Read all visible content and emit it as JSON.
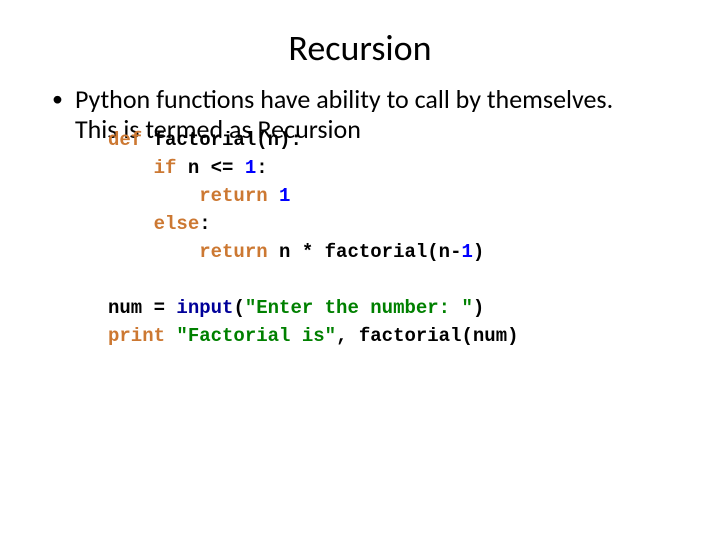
{
  "title": "Recursion",
  "bullet": "Python functions have ability to call by  themselves. This is termed as Recursion",
  "code": {
    "l1_def": "def ",
    "l1_fn": "factorial",
    "l1_rest": "(n):",
    "l2_if": "if ",
    "l2_cond": "n <= ",
    "l2_one": "1",
    "l2_colon": ":",
    "l3_ret": "return ",
    "l3_one": "1",
    "l4_else": "else",
    "l4_colon": ":",
    "l5_ret": "return ",
    "l5_expr1": "n * factorial(n-",
    "l5_expr2": "1",
    "l5_expr3": ")",
    "l6_num": "num = ",
    "l6_input": "input",
    "l6_open": "(",
    "l6_str": "\"Enter the number: \"",
    "l6_close": ")",
    "l7_print": "print ",
    "l7_str": "\"Factorial is\"",
    "l7_rest": ", factorial(num)"
  }
}
